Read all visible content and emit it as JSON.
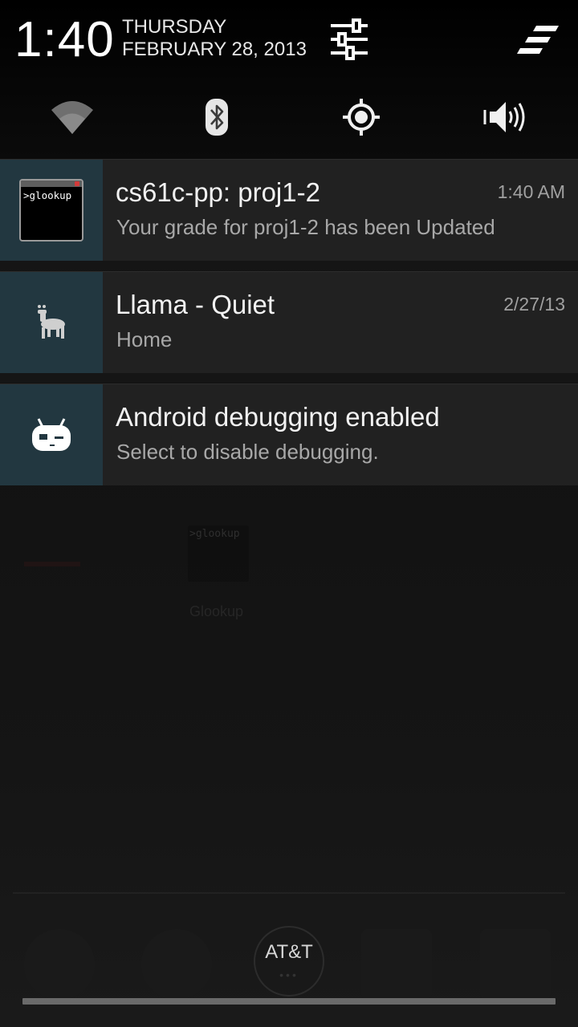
{
  "status": {
    "time": "1:40",
    "day": "THURSDAY",
    "date": "FEBRUARY 28, 2013"
  },
  "header": {
    "settings_icon": "sliders-icon",
    "clear_icon": "clear-all-icon"
  },
  "quick_toggles": [
    {
      "name": "wifi",
      "icon": "wifi-icon"
    },
    {
      "name": "bluetooth",
      "icon": "bluetooth-icon"
    },
    {
      "name": "gps",
      "icon": "gps-icon"
    },
    {
      "name": "sound",
      "icon": "volume-icon"
    }
  ],
  "notifications": [
    {
      "icon": "glookup-terminal-icon",
      "icon_text": ">glookup",
      "title": "cs61c-pp: proj1-2",
      "subtitle": "Your grade for proj1-2 has been Updated",
      "time": "1:40 AM"
    },
    {
      "icon": "llama-icon",
      "title": "Llama - Quiet",
      "subtitle": "Home",
      "time": "2/27/13"
    },
    {
      "icon": "cyanogenmod-android-icon",
      "title": "Android debugging enabled",
      "subtitle": "Select to disable debugging."
    }
  ],
  "background": {
    "app_icon_text": ">glookup",
    "app_label": "Glookup"
  },
  "footer": {
    "carrier": "AT&T"
  },
  "colors": {
    "notification_bg": "#212121",
    "icon_bg": "#223740",
    "header_bg": "#000000"
  }
}
